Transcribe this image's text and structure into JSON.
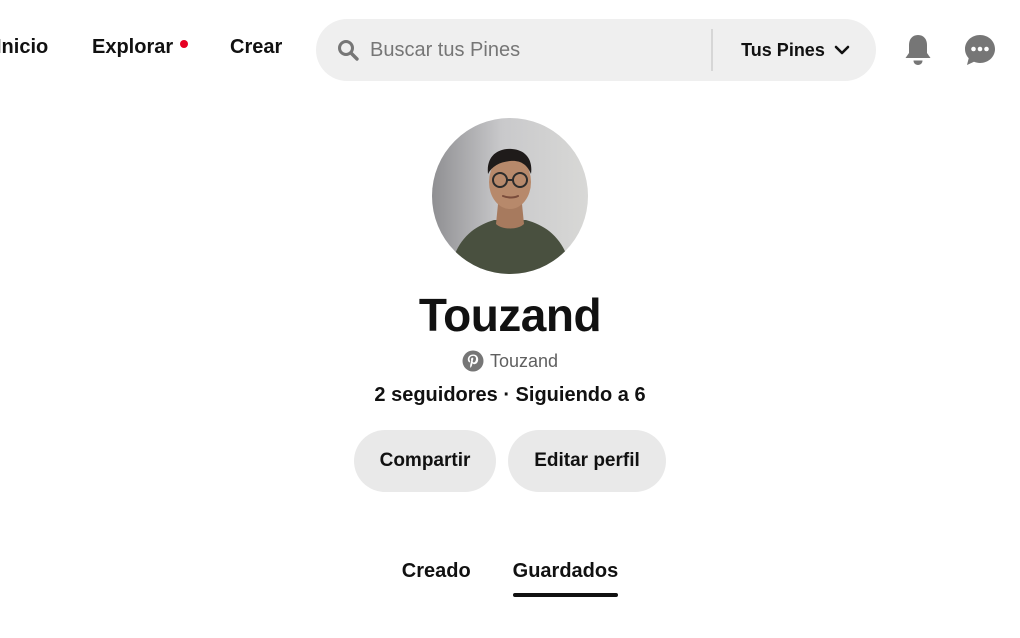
{
  "nav": {
    "links": [
      {
        "label": "Inicio"
      },
      {
        "label": "Explorar"
      },
      {
        "label": "Crear"
      }
    ],
    "notification_dot_color": "#e60023"
  },
  "search": {
    "placeholder": "Buscar tus Pines",
    "value": "",
    "scope_label": "Tus Pines",
    "icon": "search-icon"
  },
  "header_icons": [
    {
      "name": "bell-icon"
    },
    {
      "name": "messages-icon"
    }
  ],
  "profile": {
    "name": "Touzand",
    "handle": "Touzand",
    "stats": "2 seguidores · Siguiendo a 6",
    "avatar": "avatar-photo"
  },
  "actions": {
    "share_label": "Compartir",
    "edit_label": "Editar perfil"
  },
  "tabs": [
    {
      "label": "Creado",
      "active": false
    },
    {
      "label": "Guardados",
      "active": true
    }
  ],
  "colors": {
    "text": "#111111",
    "muted": "#767676",
    "button_bg": "#e9e9e9",
    "search_bg": "#efefef",
    "brand_red": "#e60023"
  }
}
